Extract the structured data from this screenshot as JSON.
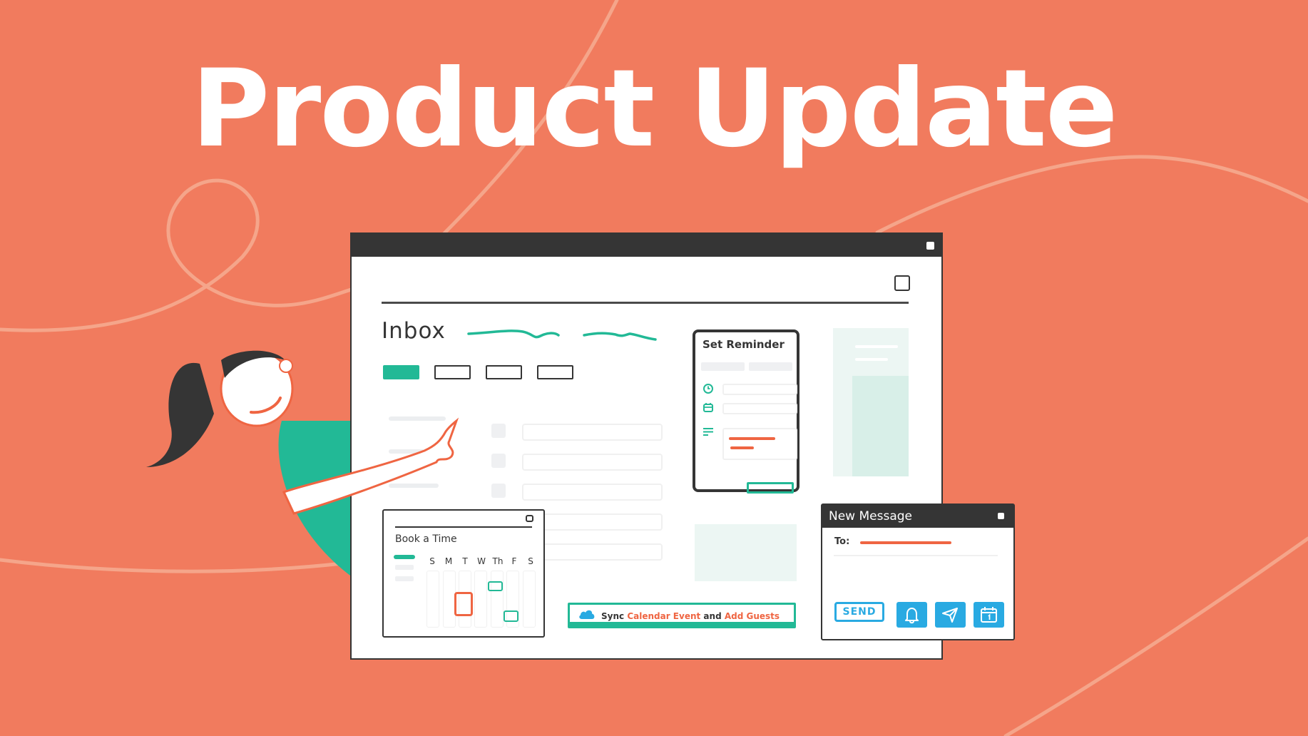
{
  "banner": {
    "headline": "Product Update",
    "colors": {
      "background": "#f17b5e",
      "accent_green": "#22b996",
      "accent_blue": "#29aae2",
      "accent_red": "#ef6542",
      "dark": "#353535"
    }
  },
  "app_window": {
    "inbox_title": "Inbox",
    "tabs": [
      {
        "state": "active"
      },
      {
        "state": "inactive"
      },
      {
        "state": "inactive"
      },
      {
        "state": "inactive"
      }
    ]
  },
  "set_reminder": {
    "title": "Set Reminder",
    "fields": [
      {
        "icon": "clock-icon"
      },
      {
        "icon": "calendar-icon"
      },
      {
        "icon": "notes-icon"
      }
    ]
  },
  "book_a_time": {
    "title": "Book a Time",
    "days": [
      "S",
      "M",
      "T",
      "W",
      "Th",
      "F",
      "S"
    ]
  },
  "sync_bar": {
    "icon": "cloud-icon",
    "prefix": "Sync",
    "highlight1": "Calendar Event",
    "middle": "and",
    "highlight2": "Add Guests"
  },
  "new_message": {
    "title": "New Message",
    "to_label": "To:",
    "send_label": "SEND",
    "action_icons": [
      "bell-icon",
      "send-icon",
      "calendar-icon"
    ]
  }
}
